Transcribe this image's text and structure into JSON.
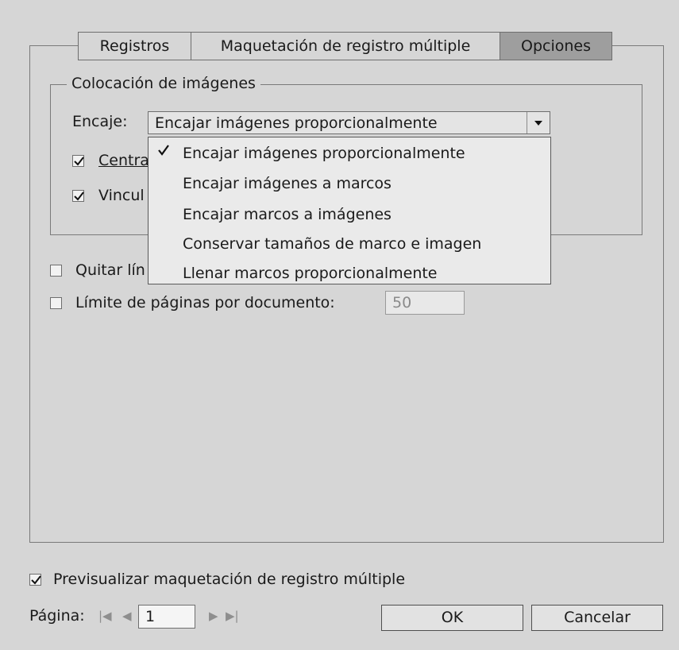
{
  "tabs": [
    {
      "label": "Registros",
      "active": false
    },
    {
      "label": "Maquetación de registro múltiple",
      "active": false
    },
    {
      "label": "Opciones",
      "active": true
    }
  ],
  "placement_group": {
    "legend": "Colocación de imágenes",
    "fit_label": "Encaje:",
    "fit_value": "Encajar imágenes proporcionalmente",
    "center_checkbox": {
      "label_visible": "Centra",
      "checked": true
    },
    "link_checkbox": {
      "label_visible": "Vincul",
      "checked": true
    }
  },
  "fit_dropdown": {
    "selected_index": 0,
    "options": [
      "Encajar imágenes proporcionalmente",
      "Encajar imágenes a marcos",
      "Encajar marcos a imágenes",
      "Conservar tamaños de marco e imagen",
      "Llenar marcos proporcionalmente"
    ]
  },
  "remove_lines_checkbox": {
    "label_visible": "Quitar lín",
    "checked": false
  },
  "page_limit": {
    "label": "Límite de páginas por documento:",
    "checked": false,
    "value": "50"
  },
  "preview_checkbox": {
    "label": "Previsualizar maquetación de registro múltiple",
    "checked": true
  },
  "pagination": {
    "label": "Página:",
    "value": "1"
  },
  "buttons": {
    "ok": "OK",
    "cancel": "Cancelar"
  },
  "colors": {
    "background": "#d6d6d6",
    "active_tab": "#9e9e9e",
    "dropdown_bg": "#eaeaea"
  }
}
